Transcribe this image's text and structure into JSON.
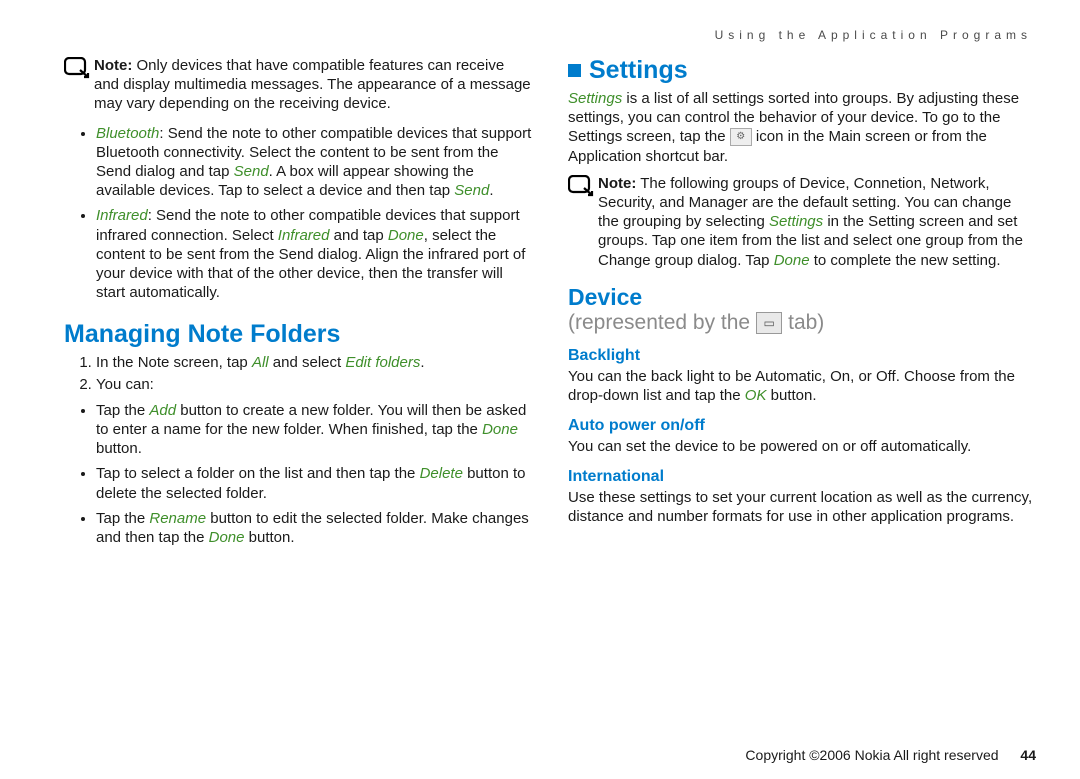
{
  "header": "Using the Application Programs",
  "left": {
    "note": {
      "label": "Note:",
      "text": " Only devices that have compatible features can receive and display multimedia messages. The appearance of a message may vary depending on the receiving device."
    },
    "bullets": [
      {
        "lead": "Bluetooth",
        "rest": ": Send the note to other compatible devices that support Bluetooth connectivity. Select the content to be sent from the Send dialog and tap ",
        "em1": "Send",
        "rest2": ". A box will appear showing the available devices. Tap to select a device and then tap ",
        "em2": "Send",
        "rest3": "."
      },
      {
        "lead": "Infrared",
        "rest": ": Send the note to other compatible devices that support infrared connection. Select ",
        "em1": "Infrared",
        "rest2": " and tap ",
        "em2": "Done",
        "rest3": ", select the content to be sent from the Send dialog. Align the infrared port of your device with that of the other device, then the transfer will start automatically."
      }
    ],
    "h1": "Managing Note Folders",
    "steps": [
      {
        "pre": "In the Note screen, tap ",
        "em1": "All",
        "mid": " and select ",
        "em2": "Edit folders",
        "post": "."
      },
      {
        "pre": "You can:",
        "em1": "",
        "mid": "",
        "em2": "",
        "post": ""
      }
    ],
    "folder_bullets": [
      {
        "pre": "Tap the ",
        "em1": "Add",
        "mid": " button to create a new folder. You will then be asked to enter a name for the new folder. When finished, tap the ",
        "em2": "Done",
        "post": " button."
      },
      {
        "pre": "Tap to select a folder on the list and then tap the ",
        "em1": "Delete",
        "mid": " button to delete the selected folder.",
        "em2": "",
        "post": ""
      },
      {
        "pre": "Tap the ",
        "em1": "Rename",
        "mid": " button to edit the selected folder. Make changes and then tap the ",
        "em2": "Done",
        "post": " button."
      }
    ]
  },
  "right": {
    "h1": "Settings",
    "intro": {
      "lead": "Settings",
      "rest": " is a list of all settings sorted into groups. By adjusting these settings, you can control the behavior of your device. To go to the Settings screen, tap the ",
      "rest2": " icon in the Main screen or from the Application shortcut bar."
    },
    "note": {
      "label": "Note:",
      "t1": " The following groups of Device, Connetion, Network, Security, and Manager are the default setting. You can change the grouping by selecting ",
      "em1": "Settings",
      "t2": " in the Setting screen and set groups. Tap one item from the list and select one group from the Change group dialog. Tap ",
      "em2": "Done",
      "t3": " to complete the new setting."
    },
    "device_h": "Device",
    "device_sub_pre": "(represented by the",
    "device_sub_post": "tab)",
    "subs": [
      {
        "h": "Backlight",
        "p_pre": "You can the back light to be Automatic, On, or Off. Choose from the drop-down list and tap the ",
        "em": "OK",
        "p_post": " button."
      },
      {
        "h": "Auto power on/off",
        "p_pre": "You can set the device to be powered on or off automatically.",
        "em": "",
        "p_post": ""
      },
      {
        "h": "International",
        "p_pre": "Use these settings to set your current location as well as the currency, distance and number formats for use in other application programs.",
        "em": "",
        "p_post": ""
      }
    ]
  },
  "footer": {
    "copy": "Copyright ©2006 Nokia All right reserved",
    "page": "44"
  }
}
